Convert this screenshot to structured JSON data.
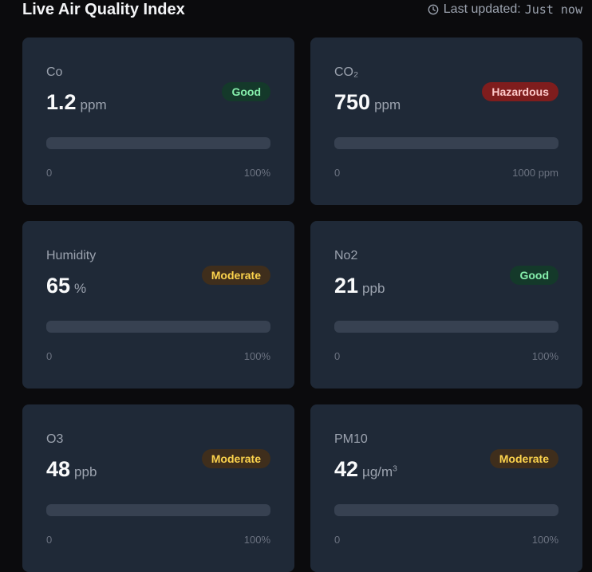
{
  "header": {
    "title": "Live Air Quality Index",
    "updated_label": "Last updated:",
    "updated_value": "Just now",
    "clock_icon": "clock-icon"
  },
  "colors": {
    "card_bg": "#1f2937",
    "track": "#374151",
    "good": "#86efac",
    "moderate": "#fcd34d",
    "hazardous": "#fecaca"
  },
  "cards": [
    {
      "label": "Co",
      "value": "1.2",
      "unit": "ppm",
      "status": "Good",
      "status_class": "good",
      "scale_min": "0",
      "scale_max": "100%",
      "fill": 0
    },
    {
      "label": "CO₂",
      "value": "750",
      "unit": "ppm",
      "status": "Hazardous",
      "status_class": "hazardous",
      "scale_min": "0",
      "scale_max": "1000 ppm",
      "fill": 0
    },
    {
      "label": "Humidity",
      "value": "65",
      "unit": "%",
      "status": "Moderate",
      "status_class": "moderate",
      "scale_min": "0",
      "scale_max": "100%",
      "fill": 0
    },
    {
      "label": "No2",
      "value": "21",
      "unit": "ppb",
      "status": "Good",
      "status_class": "good",
      "scale_min": "0",
      "scale_max": "100%",
      "fill": 0
    },
    {
      "label": "O3",
      "value": "48",
      "unit": "ppb",
      "status": "Moderate",
      "status_class": "moderate",
      "scale_min": "0",
      "scale_max": "100%",
      "fill": 0
    },
    {
      "label": "PM10",
      "value": "42",
      "unit": "µg/m",
      "unit_sup": "3",
      "status": "Moderate",
      "status_class": "moderate",
      "scale_min": "0",
      "scale_max": "100%",
      "fill": 0
    }
  ]
}
